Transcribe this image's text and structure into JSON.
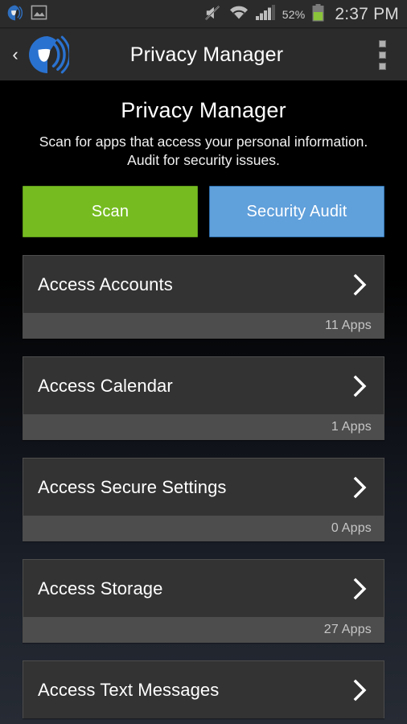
{
  "status_bar": {
    "notification_icons": [
      "app-logo-icon",
      "screenshot-image-icon"
    ],
    "mute_icon": "volume-mute-icon",
    "wifi_icon": "wifi-icon",
    "signal_icon": "cellular-signal-icon",
    "battery_percent": "52%",
    "battery_icon": "battery-icon",
    "time": "2:37 PM"
  },
  "action_bar": {
    "back_label": "‹",
    "logo_icon": "app-logo-icon",
    "title": "Privacy Manager",
    "overflow_icon": "overflow-menu-icon"
  },
  "header": {
    "title": "Privacy Manager",
    "subtitle": "Scan for apps that access your personal information. Audit for security issues."
  },
  "buttons": {
    "scan_label": "Scan",
    "audit_label": "Security Audit"
  },
  "colors": {
    "scan_green": "#76bc21",
    "audit_blue": "#60a0db",
    "card_bg": "#333333",
    "card_footer_bg": "#4d4d4d",
    "status_bar_bg": "#2b2b2b",
    "battery_green": "#8ac43a",
    "logo_blue": "#2a72d0"
  },
  "list": {
    "items": [
      {
        "label": "Access Accounts",
        "count": "11 Apps",
        "chevron": "chevron-right-icon"
      },
      {
        "label": "Access Calendar",
        "count": "1 Apps",
        "chevron": "chevron-right-icon"
      },
      {
        "label": "Access Secure Settings",
        "count": "0 Apps",
        "chevron": "chevron-right-icon"
      },
      {
        "label": "Access Storage",
        "count": "27 Apps",
        "chevron": "chevron-right-icon"
      },
      {
        "label": "Access Text Messages",
        "count": "",
        "chevron": "chevron-right-icon"
      }
    ]
  }
}
